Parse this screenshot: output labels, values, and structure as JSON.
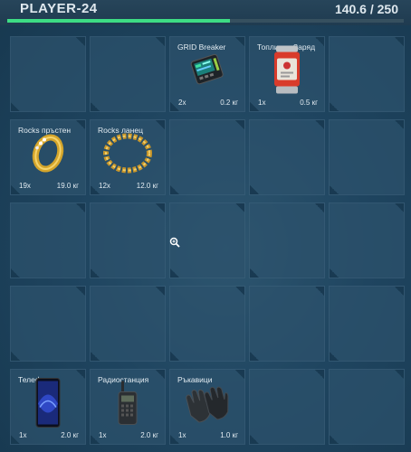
{
  "header": {
    "player_name": "PLAYER-24",
    "weight_display": "140.6 / 250",
    "weight_fraction": 0.5624,
    "bar_color": "#3ddc84"
  },
  "inventory": {
    "rows": 5,
    "columns": 5,
    "items": [
      {
        "slot": 2,
        "name": "GRID Breaker",
        "quantity": "2x",
        "weight": "0.2 кг",
        "icon": "handheld-device-icon"
      },
      {
        "slot": 3,
        "name": "Топлинен Заряд",
        "quantity": "1x",
        "weight": "0.5 кг",
        "icon": "thermal-charge-icon"
      },
      {
        "slot": 5,
        "name": "Rocks пръстен",
        "quantity": "19x",
        "weight": "19.0 кг",
        "icon": "gold-ring-icon"
      },
      {
        "slot": 6,
        "name": "Rocks ланец",
        "quantity": "12x",
        "weight": "12.0 кг",
        "icon": "gold-chain-icon"
      },
      {
        "slot": 20,
        "name": "Телефон",
        "quantity": "1x",
        "weight": "2.0 кг",
        "icon": "phone-icon"
      },
      {
        "slot": 21,
        "name": "Радиостанция",
        "quantity": "1x",
        "weight": "2.0 кг",
        "icon": "radio-icon"
      },
      {
        "slot": 22,
        "name": "Ръкавици",
        "quantity": "1x",
        "weight": "1.0 кг",
        "icon": "gloves-icon"
      }
    ]
  }
}
